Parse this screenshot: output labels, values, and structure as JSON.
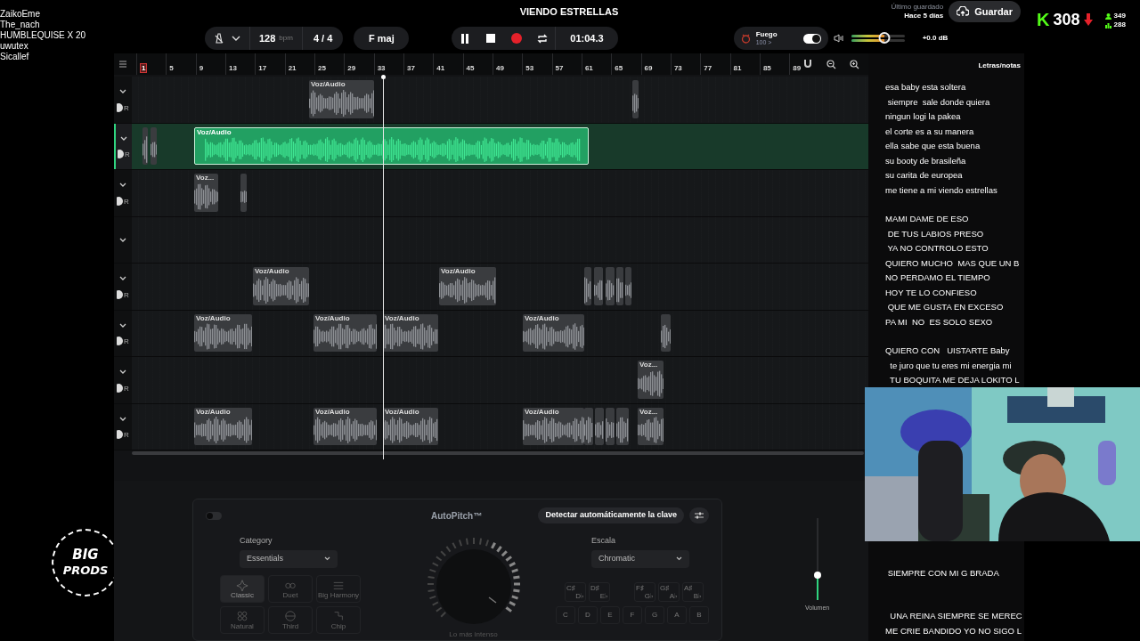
{
  "chat_overlay": {
    "names": [
      "ZaikoEme",
      "The_nach",
      "HUMBLEQUISE X 20",
      "uwutex",
      "Sicallef"
    ]
  },
  "logo": {
    "lines": [
      "BIG",
      "PRODS"
    ]
  },
  "header": {
    "title": "VIENDO ESTRELLAS",
    "tempo": "128",
    "tempo_unit": "bpm",
    "time_signature": "4 / 4",
    "key": "F maj",
    "playing": true,
    "time": "01:04.3",
    "preset": {
      "name": "Fuego",
      "value": "100 >",
      "on": true
    },
    "master_volume": {
      "level": 0.62,
      "reading": "+0.0 dB"
    },
    "save": {
      "caption": "Último guardado",
      "when": "Hace 5 días",
      "button": "Guardar"
    }
  },
  "stream_stats": {
    "logo": "K",
    "viewers": "308",
    "followers": "349",
    "subs": "288"
  },
  "ruler": {
    "marks": [
      {
        "label": "1",
        "selected": true
      },
      {
        "label": "5",
        "selected": false
      },
      {
        "label": "9",
        "selected": false
      },
      {
        "label": "13",
        "selected": false
      },
      {
        "label": "17",
        "selected": false
      },
      {
        "label": "21",
        "selected": false
      },
      {
        "label": "25",
        "selected": false
      },
      {
        "label": "29",
        "selected": false
      },
      {
        "label": "33",
        "selected": false
      },
      {
        "label": "37",
        "selected": false
      },
      {
        "label": "41",
        "selected": false
      },
      {
        "label": "45",
        "selected": false
      },
      {
        "label": "49",
        "selected": false
      },
      {
        "label": "53",
        "selected": false
      },
      {
        "label": "57",
        "selected": false
      },
      {
        "label": "61",
        "selected": false
      },
      {
        "label": "65",
        "selected": false
      },
      {
        "label": "69",
        "selected": false
      },
      {
        "label": "73",
        "selected": false
      },
      {
        "label": "77",
        "selected": false
      },
      {
        "label": "81",
        "selected": false
      },
      {
        "label": "85",
        "selected": false
      },
      {
        "label": "89",
        "selected": false
      }
    ]
  },
  "tracks": [
    {
      "selected": false,
      "pan": "R",
      "clips": [
        {
          "label": "Voz/Audio",
          "selected": false
        },
        {
          "selected": false
        }
      ]
    },
    {
      "selected": true,
      "pan": "R",
      "clips": [
        {
          "selected": false
        },
        {
          "selected": false
        },
        {
          "label": "Voz/Audio",
          "selected": true
        }
      ]
    },
    {
      "selected": false,
      "pan": "R",
      "clips": [
        {
          "label": "Voz...",
          "selected": false
        },
        {
          "selected": false
        }
      ]
    },
    {
      "selected": false
    },
    {
      "selected": false,
      "pan": "R",
      "clips": [
        {
          "label": "Voz/Audio",
          "selected": false
        },
        {
          "label": "Voz/Audio",
          "selected": false
        },
        {
          "selected": false
        },
        {
          "selected": false
        },
        {
          "selected": false
        },
        {
          "selected": false
        },
        {
          "selected": false
        }
      ]
    },
    {
      "selected": false,
      "pan": "R",
      "clips": [
        {
          "label": "Voz/Audio",
          "selected": false
        },
        {
          "label": "Voz/Audio",
          "selected": false
        },
        {
          "label": "Voz/Audio",
          "selected": false
        },
        {
          "label": "Voz/Audio",
          "selected": false
        },
        {
          "selected": false
        }
      ]
    },
    {
      "selected": false,
      "pan": "R",
      "clips": [
        {
          "label": "Voz...",
          "selected": false
        }
      ]
    },
    {
      "selected": false,
      "pan": "R",
      "clips": [
        {
          "label": "Voz/Audio",
          "selected": false
        },
        {
          "label": "Voz/Audio",
          "selected": false
        },
        {
          "label": "Voz/Audio",
          "selected": false
        },
        {
          "label": "Voz/Audio",
          "selected": false
        },
        {
          "selected": false
        },
        {
          "selected": false
        },
        {
          "selected": false
        },
        {
          "selected": false
        },
        {
          "label": "Voz...",
          "selected": false
        }
      ]
    }
  ],
  "lyrics": {
    "title": "Letras/notas",
    "stanzas": [
      [
        "esa baby esta soltera",
        " siempre  sale donde quiera",
        "ningun logi la pakea",
        "el corte es a su manera",
        "ella sabe que esta buena",
        "su booty de brasileña",
        "su carita de europea",
        "me tiene a mi viendo estrellas"
      ],
      [
        "MAMI DAME DE ESO",
        " DE TUS LABIOS PRESO",
        " YA NO CONTROLO ESTO",
        "QUIERO MUCHO  MAS QUE UN B",
        "NO PERDAMO EL TIEMPO",
        "HOY TE LO CONFIESO",
        " QUE ME GUSTA EN EXCESO",
        "PA MI  NO  ES SOLO SEXO"
      ],
      [
        "QUIERO CON   UISTARTE Baby",
        "  te juro que tu eres mi energia mi",
        "  TU BOQUITA ME DEJA LOKITO L"
      ]
    ],
    "after_overlay": [
      [
        " SIEMPRE CON MI G BRADA"
      ],
      [
        "  UNA REINA SIEMPRE SE MEREC",
        "ME CRIE BANDIDO YO NO SIGO L"
      ]
    ]
  },
  "autopitch": {
    "on": false,
    "title": "AutoPitch™",
    "detect_button": "Detectar automáticamente la clave",
    "category": {
      "label": "Category",
      "value": "Essentials"
    },
    "effects": [
      {
        "label": "Classic",
        "selected": true
      },
      {
        "label": "Duet",
        "selected": false
      },
      {
        "label": "Big Harmony",
        "selected": false
      },
      {
        "label": "Natural",
        "selected": false
      },
      {
        "label": "Third",
        "selected": false
      },
      {
        "label": "Chip",
        "selected": false
      }
    ],
    "knob_label": "Lo más intenso",
    "scale": {
      "label": "Escala",
      "value": "Chromatic"
    },
    "sharp_keys": [
      {
        "top": "C♯",
        "bottom": "D♭"
      },
      {
        "top": "D♯",
        "bottom": "E♭"
      },
      {
        "top": "F♯",
        "bottom": "G♭"
      },
      {
        "top": "G♯",
        "bottom": "A♭"
      },
      {
        "top": "A♯",
        "bottom": "B♭"
      }
    ],
    "natural_keys": [
      "C",
      "D",
      "E",
      "F",
      "G",
      "A",
      "B"
    ]
  },
  "volume": {
    "label": "Volumen",
    "level": 0.3
  }
}
